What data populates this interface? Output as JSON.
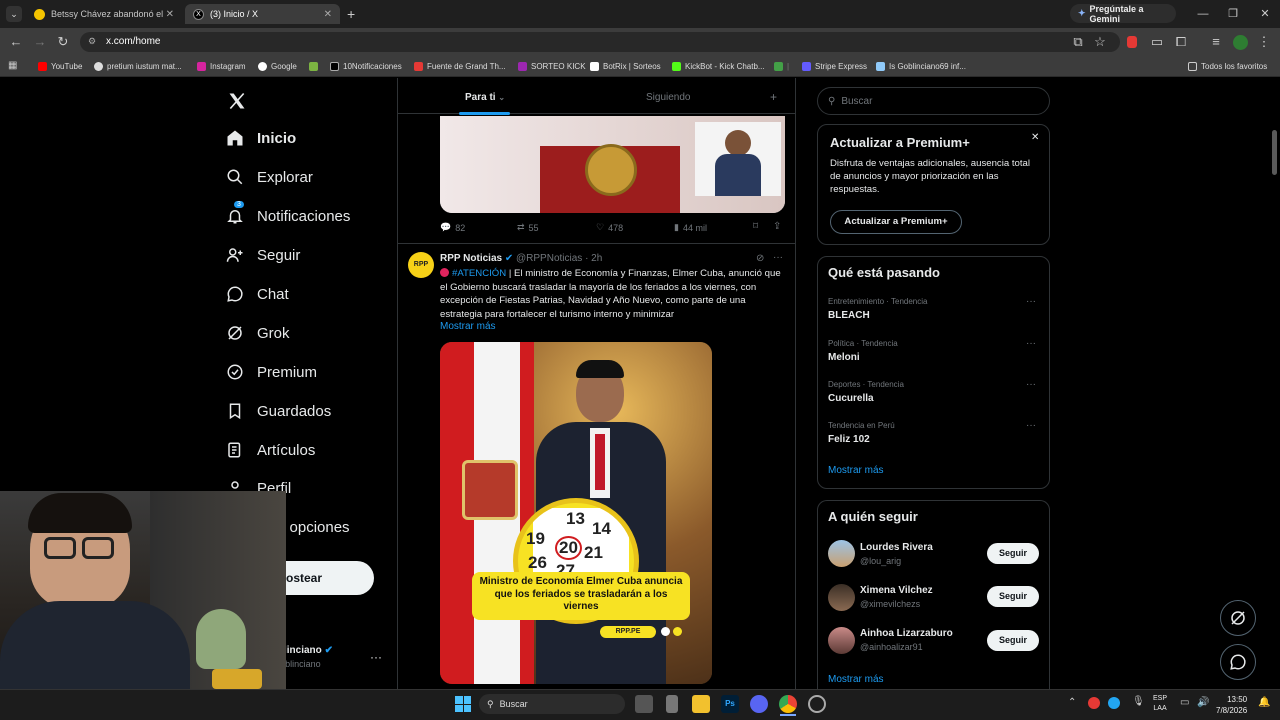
{
  "browser": {
    "tabs": [
      {
        "label": "Betssy Chávez abandonó el Per",
        "active": false
      },
      {
        "label": "(3) Inicio / X",
        "active": true
      }
    ],
    "gemini": "Pregúntale a Gemini",
    "url": "x.com/home",
    "bookmarks": [
      "YouTube",
      "pretium iustum mat...",
      "Instagram",
      "Google",
      "10Notificaciones",
      "Fuente de Grand Th...",
      "SORTEO KICK",
      "BotRix | Sorteos",
      "KickBot - Kick Chatb...",
      "Stripe Express",
      "Is Goblinciano69 inf..."
    ],
    "all_favs": "Todos los favoritos"
  },
  "nav": {
    "items": [
      "Inicio",
      "Explorar",
      "Notificaciones",
      "Seguir",
      "Chat",
      "Grok",
      "Premium",
      "Guardados",
      "Artículos",
      "Perfil",
      "Más opciones"
    ],
    "notif_badge": "3",
    "post_btn": "Postear",
    "user_name": "Goblinciano",
    "user_handle": "@Goblinciano"
  },
  "feed": {
    "tab_foryou": "Para ti",
    "tab_following": "Siguiendo",
    "prev_stats": {
      "replies": "82",
      "reposts": "55",
      "likes": "478",
      "views": "44 mil"
    },
    "post": {
      "author": "RPP Noticias",
      "handle": "@RPPNoticias",
      "time": "· 2h",
      "hashtag": "#ATENCIÓN",
      "text": " | El ministro de Economía y Finanzas, Elmer Cuba, anunció que el Gobierno buscará trasladar la mayoría de los feriados a los viernes, con excepción de Fiestas Patrias, Navidad y Año Nuevo, como parte de una estrategia para fortalecer el turismo interno y minimizar",
      "more": "Mostrar más",
      "image_caption": "Ministro de Economía Elmer Cuba anuncia que los feriados se trasladarán a los viernes",
      "image_brand": "RPP.PE",
      "calendar": [
        "13",
        "14",
        "19",
        "20",
        "21",
        "26",
        "27"
      ]
    }
  },
  "right": {
    "search_placeholder": "Buscar",
    "premium": {
      "title": "Actualizar a Premium+",
      "desc": "Disfruta de ventajas adicionales, ausencia total de anuncios y mayor priorización en las respuestas.",
      "btn": "Actualizar a Premium+"
    },
    "trends_title": "Qué está pasando",
    "trends": [
      {
        "cat": "Entretenimiento · Tendencia",
        "name": "BLEACH"
      },
      {
        "cat": "Política · Tendencia",
        "name": "Meloni"
      },
      {
        "cat": "Deportes · Tendencia",
        "name": "Cucurella"
      },
      {
        "cat": "Tendencia en Perú",
        "name": "Feliz 102"
      }
    ],
    "trends_more": "Mostrar más",
    "follow_title": "A quién seguir",
    "follow": [
      {
        "name": "Lourdes Rivera",
        "handle": "@lou_arig",
        "btn": "Seguir"
      },
      {
        "name": "Ximena Vilchez",
        "handle": "@ximevilchezs",
        "btn": "Seguir"
      },
      {
        "name": "Ainhoa Lizarzaburo",
        "handle": "@ainhoalizar91",
        "btn": "Seguir"
      }
    ],
    "follow_more": "Mostrar más"
  },
  "taskbar": {
    "search": "Buscar",
    "lang": "ESP",
    "lang2": "LAA",
    "time": "13:50",
    "date": "7/8/2026"
  }
}
